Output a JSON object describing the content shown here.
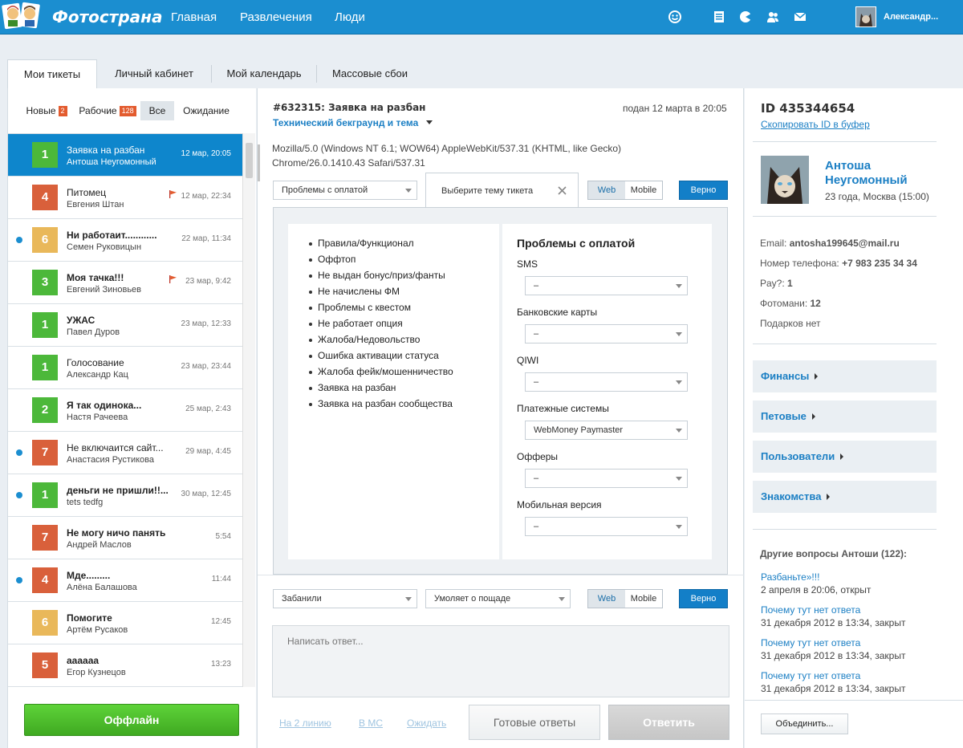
{
  "header": {
    "logo_text": "Фотострана",
    "nav": [
      "Главная",
      "Развлечения",
      "Люди"
    ],
    "user_name": "Александр..."
  },
  "tabs": [
    "Мои тикеты",
    "Личный кабинет",
    "Мой календарь",
    "Массовые сбои"
  ],
  "filters": [
    {
      "label": "Новые",
      "count": "2"
    },
    {
      "label": "Рабочие",
      "count": "128"
    },
    {
      "label": "Все",
      "count": ""
    },
    {
      "label": "Ожидание",
      "count": ""
    }
  ],
  "tickets": [
    {
      "num": "1",
      "color": "#4cb83a",
      "title": "Заявка на разбан",
      "user": "Антоша Неугомонный",
      "date": "12 мар, 20:05",
      "bold": false,
      "dot": false,
      "flag": false,
      "active": true
    },
    {
      "num": "4",
      "color": "#d9603b",
      "title": "Питомец",
      "user": "Евгения Штан",
      "date": "12 мар, 22:34",
      "bold": false,
      "dot": false,
      "flag": true,
      "active": false
    },
    {
      "num": "6",
      "color": "#e9b85a",
      "title": "Ни работаит............",
      "user": "Семен Руковицын",
      "date": "22 мар, 11:34",
      "bold": true,
      "dot": true,
      "flag": false,
      "active": false
    },
    {
      "num": "3",
      "color": "#4cb83a",
      "title": "Моя тачка!!!",
      "user": "Евгений Зиновьев",
      "date": "23 мар, 9:42",
      "bold": true,
      "dot": false,
      "flag": true,
      "active": false
    },
    {
      "num": "1",
      "color": "#4cb83a",
      "title": "УЖАС",
      "user": "Павел Дуров",
      "date": "23 мар, 12:33",
      "bold": true,
      "dot": false,
      "flag": false,
      "active": false
    },
    {
      "num": "1",
      "color": "#4cb83a",
      "title": "Голосование",
      "user": "Александр Кац",
      "date": "23 мар, 23:44",
      "bold": false,
      "dot": false,
      "flag": false,
      "active": false
    },
    {
      "num": "2",
      "color": "#4cb83a",
      "title": "Я так одинока...",
      "user": "Настя Рачеева",
      "date": "25 мар, 2:43",
      "bold": true,
      "dot": false,
      "flag": false,
      "active": false
    },
    {
      "num": "7",
      "color": "#d9603b",
      "title": "Не включаится сайт...",
      "user": "Анастасия Рустикова",
      "date": "29 мар, 4:45",
      "bold": false,
      "dot": true,
      "flag": false,
      "active": false
    },
    {
      "num": "1",
      "color": "#4cb83a",
      "title": "деньги не пришли!!...",
      "user": "tets tedfg",
      "date": "30 мар, 12:45",
      "bold": true,
      "dot": true,
      "flag": false,
      "active": false
    },
    {
      "num": "7",
      "color": "#d9603b",
      "title": "Не могу ничо панять",
      "user": "Андрей Маслов",
      "date": "5:54",
      "bold": true,
      "dot": false,
      "flag": false,
      "active": false
    },
    {
      "num": "4",
      "color": "#d9603b",
      "title": "Мде.........",
      "user": "Алёна Балашова",
      "date": "11:44",
      "bold": true,
      "dot": true,
      "flag": false,
      "active": false
    },
    {
      "num": "6",
      "color": "#e9b85a",
      "title": "Помогите",
      "user": "Артём Русаков",
      "date": "12:45",
      "bold": true,
      "dot": false,
      "flag": false,
      "active": false
    },
    {
      "num": "5",
      "color": "#d9603b",
      "title": "аааааа",
      "user": "Егор Кузнецов",
      "date": "13:23",
      "bold": true,
      "dot": false,
      "flag": false,
      "active": false
    }
  ],
  "offline_label": "Оффлайн",
  "ticket": {
    "title": "#632315: Заявка на разбан",
    "submitted": "подан 12 марта в 20:05",
    "theme": "Технический бекграунд и тема",
    "ua_line1": "Mozilla/5.0 (Windows NT 6.1; WOW64) AppleWebKit/537.31 (KHTML, like Gecko)",
    "ua_line2": "Chrome/26.0.1410.43 Safari/537.31"
  },
  "controls1": {
    "category": "Проблемы с оплатой",
    "topic_tab": "Выберите тему тикета",
    "web": "Web",
    "mobile": "Mobile",
    "verno": "Верно"
  },
  "topics": [
    "Правила/Функционал",
    "Оффтоп",
    "Не выдан бонус/приз/фанты",
    "Не начислены ФМ",
    "Проблемы с квестом",
    "Не работает опция",
    "Жалоба/Недовольство",
    "Ошибка активации статуса",
    "Жалоба фейк/мошенничество",
    "Заявка на разбан",
    "Заявка на разбан сообщества"
  ],
  "payment": {
    "title": "Проблемы с оплатой",
    "fields": [
      {
        "label": "SMS",
        "value": "–"
      },
      {
        "label": "Банковские карты",
        "value": "–"
      },
      {
        "label": "QIWI",
        "value": "–"
      },
      {
        "label": "Платежные системы",
        "value": "WebMoney Paymaster"
      },
      {
        "label": "Офферы",
        "value": "–"
      },
      {
        "label": "Мобильная версия",
        "value": "–"
      }
    ]
  },
  "controls2": {
    "status": "Забанили",
    "subject": "Умоляет о пощаде",
    "web": "Web",
    "mobile": "Mobile",
    "verno": "Верно"
  },
  "reply": {
    "placeholder": "Написать ответ...",
    "line2": "На 2 линию",
    "ms": "В МС",
    "wait": "Ожидать",
    "ready": "Готовые ответы",
    "answer": "Ответить"
  },
  "profile": {
    "id": "ID 435344654",
    "copy": "Скопировать ID в буфер",
    "name_line1": "Антоша",
    "name_line2": "Неугомонный",
    "age_city": "23 года, Москва (15:00)",
    "email_label": "Email:",
    "email": "antosha199645@mail.ru",
    "phone_label": "Номер телефона:",
    "phone": "+7 983 235 34 34",
    "pay_label": "Pay?:",
    "pay": "1",
    "photomani_label": "Фотомани:",
    "photomani": "12",
    "gifts": "Подарков нет"
  },
  "categories": [
    "Финансы",
    "Петовые",
    "Пользователи",
    "Знакомства"
  ],
  "other": {
    "title": "Другие вопросы Антоши (122):",
    "items": [
      {
        "link": "Разбаньте»!!!",
        "meta": "2 апреля в 20:06, открыт"
      },
      {
        "link": "Почему тут нет ответа",
        "meta": "31 декабря 2012 в 13:34, закрыт"
      },
      {
        "link": "Почему тут нет ответа",
        "meta": "31 декабря 2012 в 13:34, закрыт"
      },
      {
        "link": "Почему тут нет ответа",
        "meta": "31 декабря 2012 в 13:34, закрыт"
      }
    ]
  },
  "merge_label": "Объединить...",
  "colors": {
    "header": "#1b8ed0",
    "active_row": "#0e86cc",
    "green": "#4cb83a",
    "orange": "#d9603b",
    "yellow": "#e9b85a",
    "link": "#1b7fc4"
  }
}
